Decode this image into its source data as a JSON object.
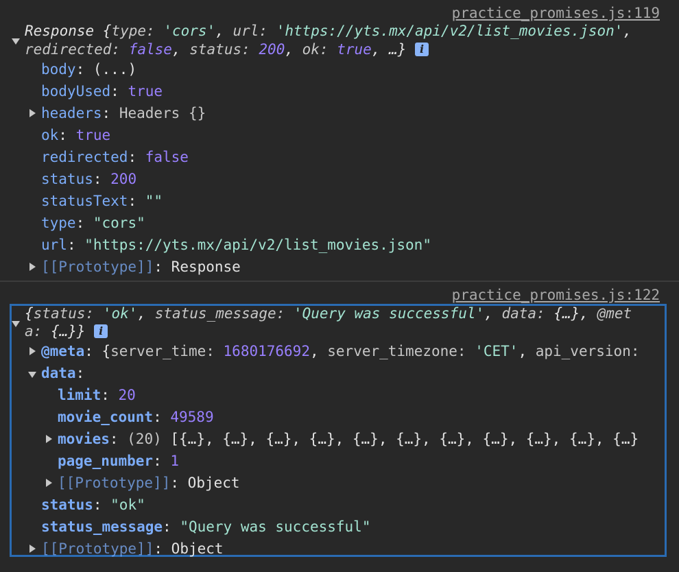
{
  "entry1": {
    "source": "practice_promises.js:119",
    "summary_line1": {
      "prefix": "Response {",
      "type_key": "type",
      "type_val": "'cors'",
      "url_key": "url",
      "url_val": "'https://yts.mx/api/v2/list_movies.json'"
    },
    "summary_line2": {
      "redirected_key": "redirected",
      "redirected_val": "false",
      "status_key": "status",
      "status_val": "200",
      "ok_key": "ok",
      "ok_val": "true",
      "ellipsis": "…}"
    },
    "info_icon": "i",
    "props": {
      "body_key": "body",
      "body_val": "(...)",
      "bodyUsed_key": "bodyUsed",
      "bodyUsed_val": "true",
      "headers_key": "headers",
      "headers_val": "Headers {}",
      "ok_key": "ok",
      "ok_val": "true",
      "redirected_key": "redirected",
      "redirected_val": "false",
      "status_key": "status",
      "status_val": "200",
      "statusText_key": "statusText",
      "statusText_val": "\"\"",
      "type_key": "type",
      "type_val": "\"cors\"",
      "url_key": "url",
      "url_val": "\"https://yts.mx/api/v2/list_movies.json\"",
      "proto_key": "[[Prototype]]",
      "proto_val": "Response"
    }
  },
  "entry2": {
    "source": "practice_promises.js:122",
    "summary_line1": {
      "status_key": "status",
      "status_val": "'ok'",
      "msg_key": "status_message",
      "msg_val": "'Query was successful'",
      "data_key": "data",
      "data_val": "{…}",
      "meta_key_part": "@met"
    },
    "summary_line2": {
      "meta_key_rest": "a",
      "meta_val": "{…}}"
    },
    "info_icon": "i",
    "meta": {
      "key": "@meta",
      "server_time_key": "server_time",
      "server_time_val": "1680176692",
      "server_timezone_key": "server_timezone",
      "server_timezone_val": "'CET'",
      "api_version_key": "api_version"
    },
    "data": {
      "key": "data",
      "limit_key": "limit",
      "limit_val": "20",
      "movie_count_key": "movie_count",
      "movie_count_val": "49589",
      "movies_key": "movies",
      "movies_count": "(20)",
      "movies_preview": "[{…}, {…}, {…}, {…}, {…}, {…}, {…}, {…}, {…}, {…}, {…}",
      "page_number_key": "page_number",
      "page_number_val": "1",
      "proto_key": "[[Prototype]]",
      "proto_val": "Object"
    },
    "status_key": "status",
    "status_val": "\"ok\"",
    "status_message_key": "status_message",
    "status_message_val": "\"Query was successful\"",
    "proto_key": "[[Prototype]]",
    "proto_val": "Object"
  }
}
